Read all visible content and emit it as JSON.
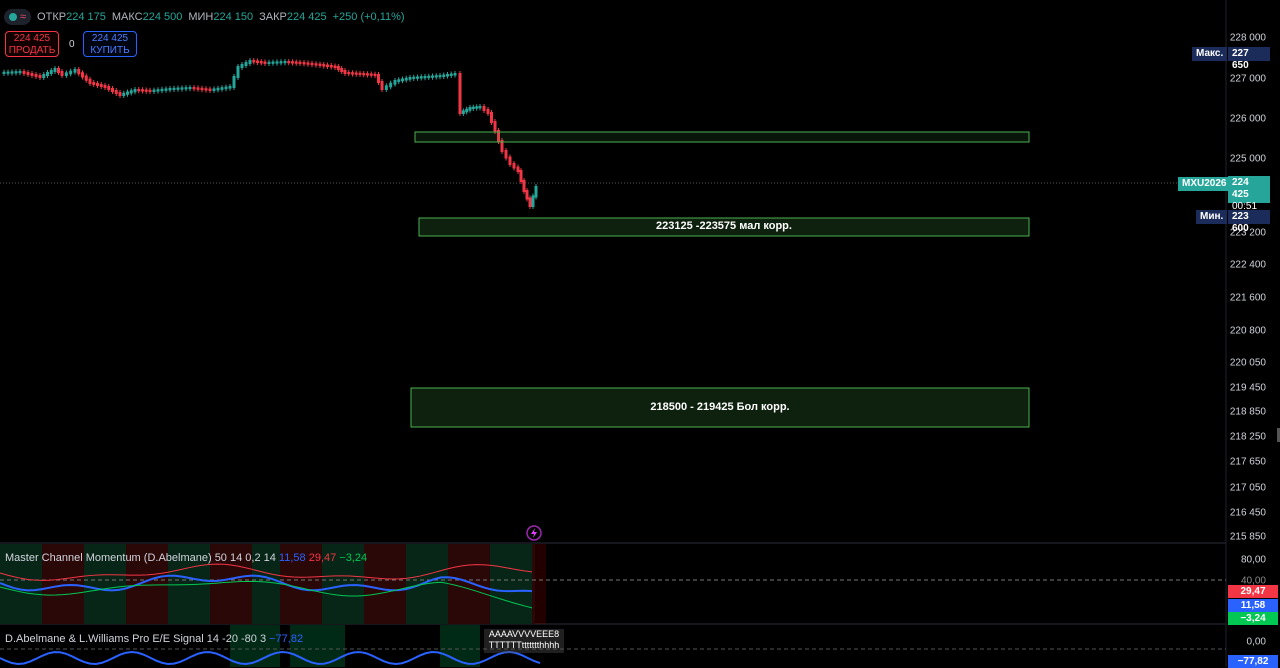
{
  "legend": {
    "open_label": "ОТКР",
    "open_value": "224 175",
    "high_label": "МАКС",
    "high_value": "224 500",
    "low_label": "МИН",
    "low_value": "224 150",
    "close_label": "ЗАКР",
    "close_value": "224 425",
    "change": "+250 (+0,11%)"
  },
  "trade": {
    "sell_price": "224 425",
    "sell_label": "ПРОДАТЬ",
    "spread": "0",
    "buy_price": "224 425",
    "buy_label": "КУПИТЬ"
  },
  "price_axis": {
    "ticks": [
      "228 000",
      "227 000",
      "226 000",
      "225 000",
      "223 200",
      "222 400",
      "221 600",
      "220 800",
      "220 050",
      "219 450",
      "218 850",
      "218 250",
      "217 650",
      "217 050",
      "216 450",
      "215 850"
    ],
    "max_label": "Макс.",
    "max_value": "227 650",
    "symbol": "MXU2026",
    "last_price": "224 425",
    "countdown": "00:51",
    "min_label": "Мин.",
    "min_value": "223 600"
  },
  "zones": {
    "small_correction": "223125 -223575 мал корр.",
    "big_correction": "218500 - 219425 Бол корр."
  },
  "indicator1": {
    "title": "Master Channel Momentum (D.Abelmane) 50 14 0,2 14",
    "v1": "11,58",
    "v2": "29,47",
    "v3": "−3,24",
    "axis_top": "80,00",
    "axis_mid": "40,00",
    "tag_red": "29,47",
    "tag_blue": "11,58",
    "tag_green": "−3,24"
  },
  "indicator2": {
    "title": "D.Abelmane & L.Williams Pro E/E Signal 14 -20 -80 3",
    "value": "−77,82",
    "axis_zero": "0,00",
    "tag_value": "−77,82",
    "overlay_text": "AAAAVVVVEEE8 TTTTTTttttttthhhh"
  },
  "colors": {
    "up": "#26a69a",
    "down": "#f23645",
    "zone": "#4caf50",
    "blue": "#2962ff",
    "red": "#f23645",
    "green": "#00c853"
  }
}
